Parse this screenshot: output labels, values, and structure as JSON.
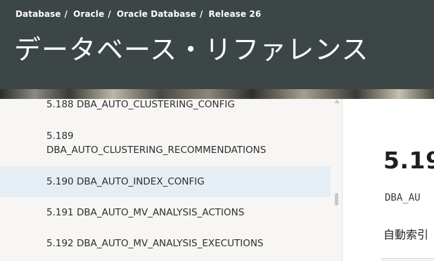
{
  "header": {
    "breadcrumb": [
      "Database",
      "Oracle",
      "Oracle Database",
      "Release 26"
    ],
    "separator": "/",
    "title": "データベース・リファレンス"
  },
  "toc": {
    "items": [
      {
        "text": "5.188 DBA_AUTO_CLUSTERING_CONFIG"
      },
      {
        "text": "5.189 DBA_AUTO_CLUSTERING_RECOMMENDATIONS",
        "line1": "5.189",
        "line2": "DBA_AUTO_CLUSTERING_RECOMMENDATIONS"
      },
      {
        "text": "5.190 DBA_AUTO_INDEX_CONFIG",
        "active": true
      },
      {
        "text": "5.191 DBA_AUTO_MV_ANALYSIS_ACTIONS"
      },
      {
        "text": "5.192 DBA_AUTO_MV_ANALYSIS_EXECUTIONS"
      }
    ]
  },
  "content": {
    "section_number": "5.19",
    "code": "DBA_AU",
    "description": "自動索引"
  }
}
